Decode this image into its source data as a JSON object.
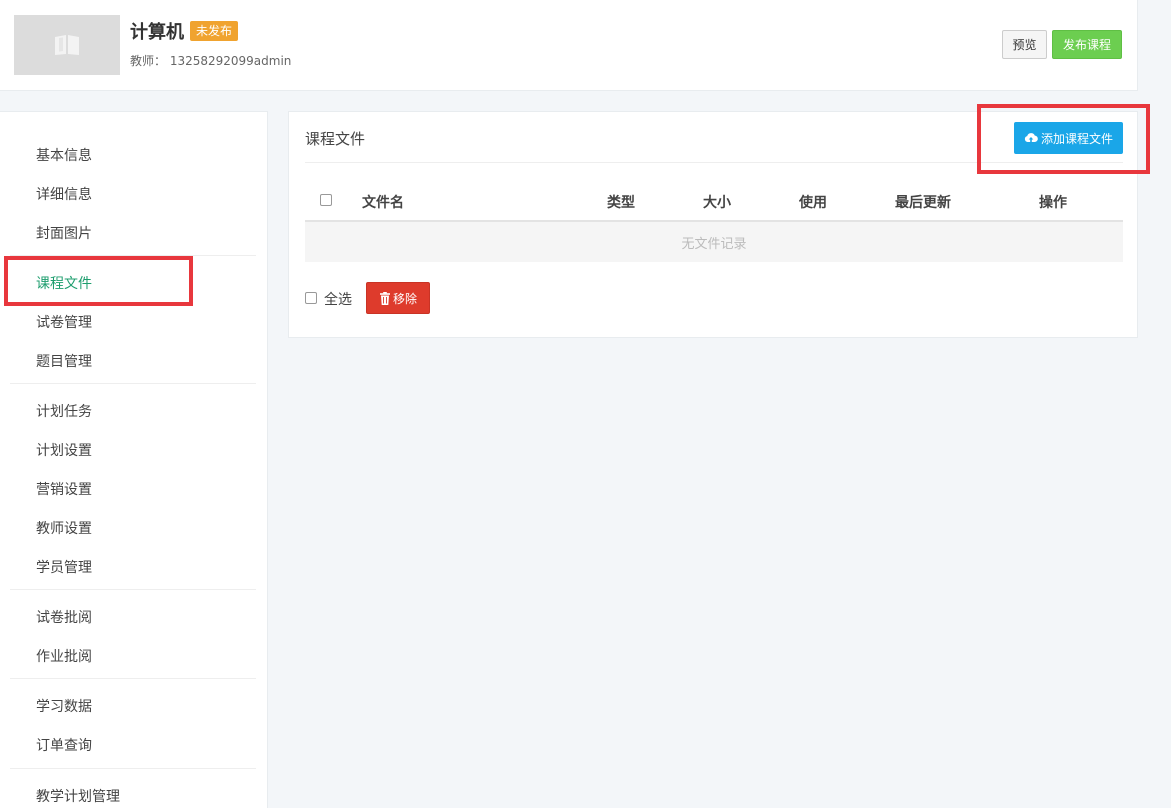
{
  "header": {
    "course_title": "计算机",
    "status_badge": "未发布",
    "teacher_line": "教师： 13258292099admin",
    "preview_label": "预览",
    "publish_label": "发布课程"
  },
  "sidebar": {
    "groups": [
      [
        "基本信息",
        "详细信息",
        "封面图片"
      ],
      [
        "课程文件",
        "试卷管理",
        "题目管理"
      ],
      [
        "计划任务",
        "计划设置",
        "营销设置",
        "教师设置",
        "学员管理"
      ],
      [
        "试卷批阅",
        "作业批阅"
      ],
      [
        "学习数据",
        "订单查询"
      ],
      [
        "教学计划管理"
      ]
    ],
    "active": "课程文件"
  },
  "panel": {
    "title": "课程文件",
    "add_label": "添加课程文件",
    "columns": [
      "文件名",
      "类型",
      "大小",
      "使用",
      "最后更新",
      "操作"
    ],
    "empty_text": "无文件记录",
    "select_all_label": "全选",
    "remove_label": "移除"
  },
  "colors": {
    "accent_blue": "#1aa6e8",
    "publish_green": "#6cce50",
    "badge_orange": "#f0a32f",
    "remove_red": "#de3b2c",
    "active_nav": "#1e9e6e",
    "highlight_red": "#e8373d"
  }
}
